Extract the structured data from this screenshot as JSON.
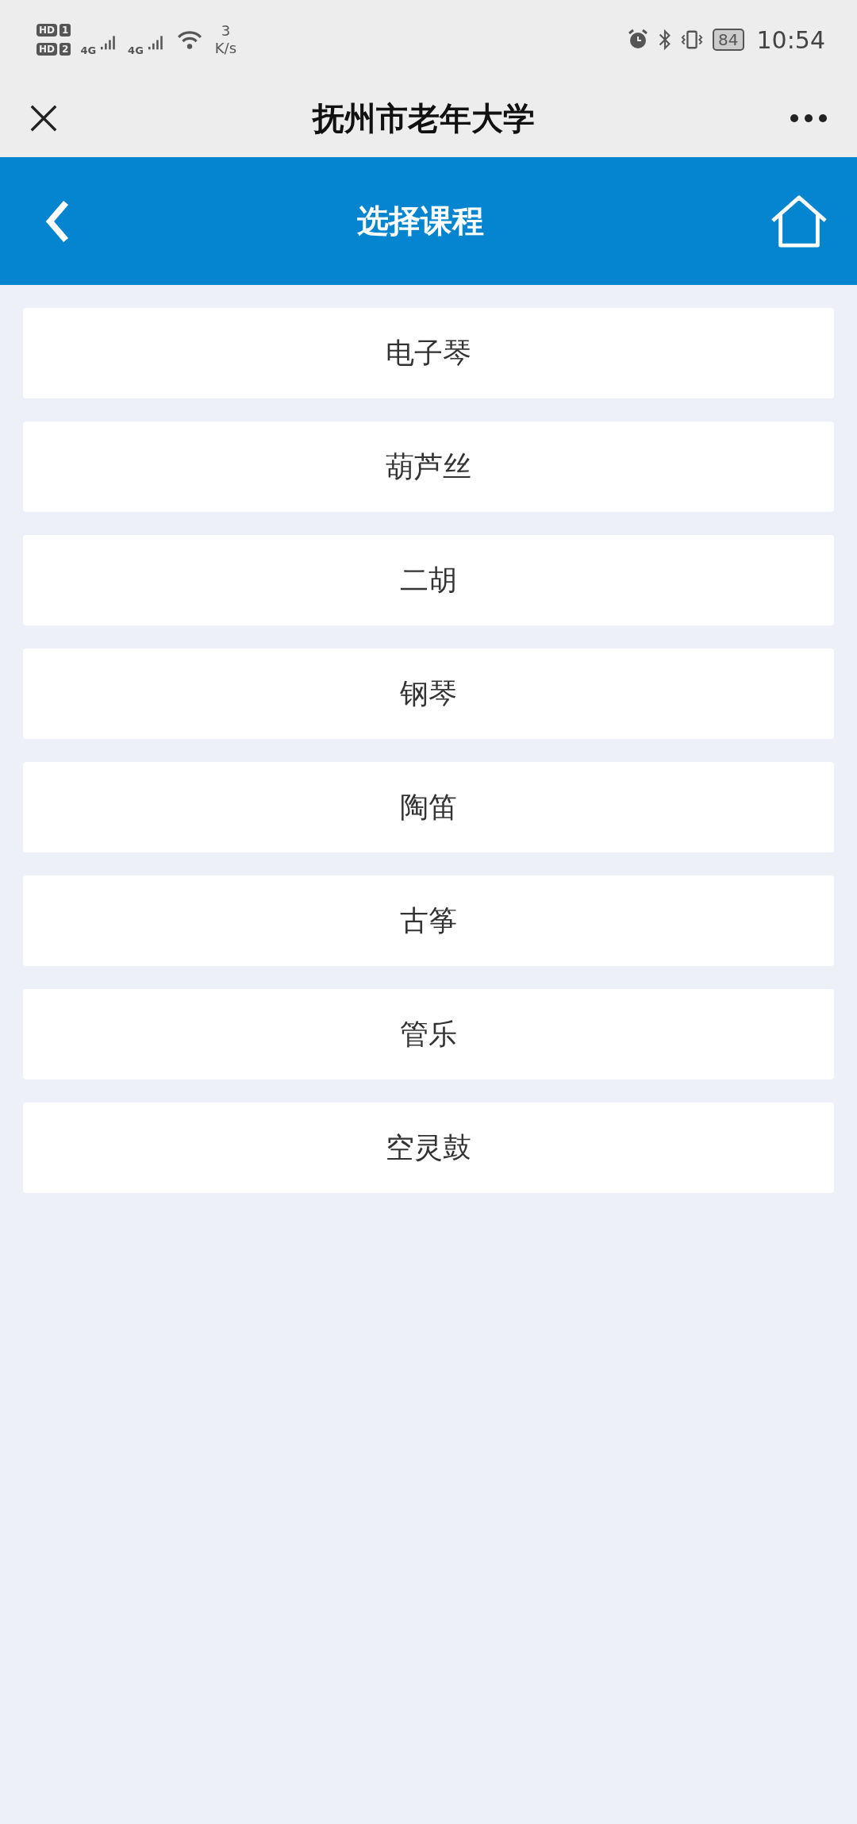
{
  "status_bar": {
    "sims": [
      {
        "hd": "HD",
        "slot": "1",
        "network": "4G"
      },
      {
        "hd": "HD",
        "slot": "2",
        "network": "4G"
      }
    ],
    "speed_value": "3",
    "speed_unit": "K/s",
    "battery": "84",
    "time": "10:54"
  },
  "title_bar": {
    "title": "抚州市老年大学"
  },
  "header": {
    "title": "选择课程"
  },
  "courses": [
    {
      "label": "电子琴"
    },
    {
      "label": "葫芦丝"
    },
    {
      "label": "二胡"
    },
    {
      "label": "钢琴"
    },
    {
      "label": "陶笛"
    },
    {
      "label": "古筝"
    },
    {
      "label": "管乐"
    },
    {
      "label": "空灵鼓"
    }
  ]
}
